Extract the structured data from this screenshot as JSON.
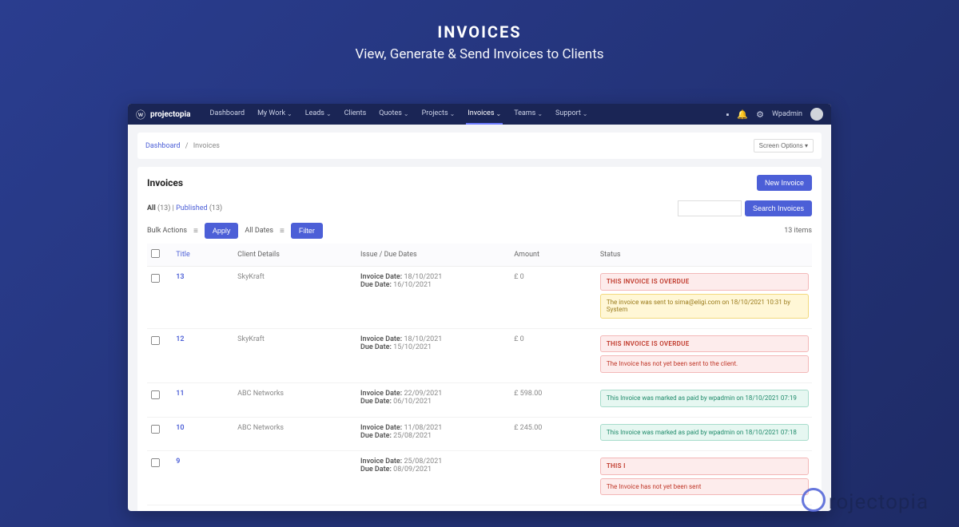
{
  "marketing": {
    "title": "INVOICES",
    "subtitle": "View, Generate & Send Invoices to Clients"
  },
  "brand": "projectopia",
  "nav": {
    "items": [
      {
        "label": "Dashboard"
      },
      {
        "label": "My Work",
        "drop": true
      },
      {
        "label": "Leads",
        "drop": true
      },
      {
        "label": "Clients"
      },
      {
        "label": "Quotes",
        "drop": true
      },
      {
        "label": "Projects",
        "drop": true
      },
      {
        "label": "Invoices",
        "drop": true,
        "active": true
      },
      {
        "label": "Teams",
        "drop": true
      },
      {
        "label": "Support",
        "drop": true
      }
    ],
    "user": "Wpadmin"
  },
  "crumb": {
    "root": "Dashboard",
    "current": "Invoices",
    "screen_options": "Screen Options ▾"
  },
  "page": {
    "heading": "Invoices",
    "new_btn": "New Invoice",
    "all_label": "All",
    "all_count": "(13)",
    "pub_label": "Published",
    "pub_count": "(13)",
    "bulk": "Bulk Actions",
    "apply": "Apply",
    "alldates": "All Dates",
    "filter": "Filter",
    "search_btn": "Search Invoices",
    "items_text": "13 items"
  },
  "cols": {
    "title": "Title",
    "client": "Client Details",
    "dates": "Issue / Due Dates",
    "amount": "Amount",
    "status": "Status"
  },
  "rows": [
    {
      "id": "13",
      "client": "SkyKraft",
      "invoice_label": "Invoice Date:",
      "invoice_date": "18/10/2021",
      "due_label": "Due Date:",
      "due_date": "16/10/2021",
      "amount": "£ 0",
      "badges": [
        {
          "cls": "overdue",
          "text": "THIS INVOICE IS OVERDUE"
        },
        {
          "cls": "sentmsg",
          "text": "The invoice was sent to sima@eligi.com on 18/10/2021 10:31 by System"
        }
      ]
    },
    {
      "id": "12",
      "client": "SkyKraft",
      "invoice_label": "Invoice Date:",
      "invoice_date": "18/10/2021",
      "due_label": "Due Date:",
      "due_date": "15/10/2021",
      "amount": "£ 0",
      "badges": [
        {
          "cls": "overdue",
          "text": "THIS INVOICE IS OVERDUE"
        },
        {
          "cls": "notsent",
          "text": "The Invoice has not yet been sent to the client."
        }
      ]
    },
    {
      "id": "11",
      "client": "ABC Networks",
      "invoice_label": "Invoice Date:",
      "invoice_date": "22/09/2021",
      "due_label": "Due Date:",
      "due_date": "06/10/2021",
      "amount": "£ 598.00",
      "badges": [
        {
          "cls": "paid",
          "text": "This Invoice was marked as paid by wpadmin on 18/10/2021 07:19"
        }
      ]
    },
    {
      "id": "10",
      "client": "ABC Networks",
      "invoice_label": "Invoice Date:",
      "invoice_date": "11/08/2021",
      "due_label": "Due Date:",
      "due_date": "25/08/2021",
      "amount": "£ 245.00",
      "badges": [
        {
          "cls": "paid",
          "text": "This Invoice was marked as paid by wpadmin on 18/10/2021 07:18"
        }
      ]
    },
    {
      "id": "9",
      "client": "",
      "invoice_label": "Invoice Date:",
      "invoice_date": "25/08/2021",
      "due_label": "Due Date:",
      "due_date": "08/09/2021",
      "amount": "",
      "badges": [
        {
          "cls": "overdue",
          "text": "THIS I"
        },
        {
          "cls": "notsent",
          "text": "The Invoice has not yet been sent"
        }
      ]
    }
  ],
  "watermark": "rojectopia"
}
